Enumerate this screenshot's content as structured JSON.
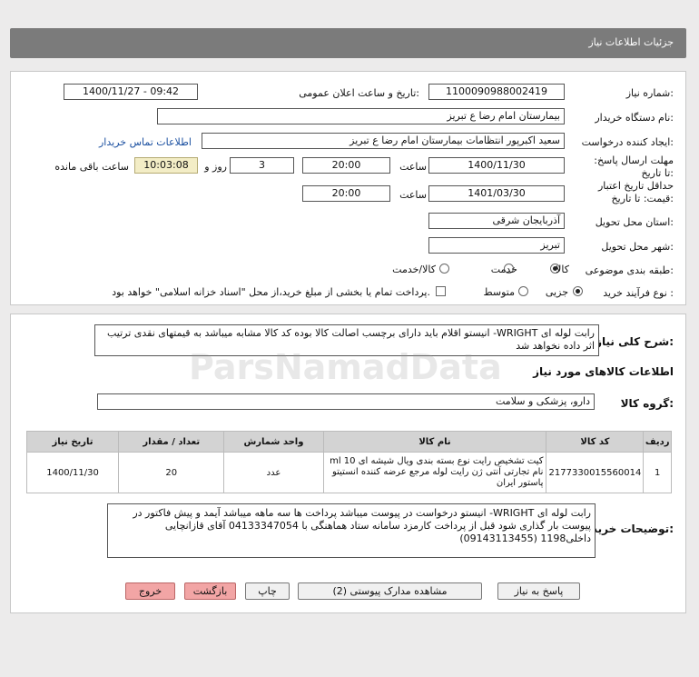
{
  "header": {
    "title": "جزئیات اطلاعات نیاز"
  },
  "form": {
    "need_number_label": "شماره نیاز:",
    "need_number": "1100090988002419",
    "announce_label": "تاریخ و ساعت اعلان عمومی:",
    "announce_value": "1400/11/27 - 09:42",
    "buyer_label": "نام دستگاه خریدار:",
    "buyer_value": "بیمارستان امام رضا  ع  تبریز",
    "creator_label": "ایجاد کننده درخواست:",
    "creator_value": "سعید اکبرپور انتظامات بیمارستان امام رضا  ع  تبریز",
    "contact_link": "اطلاعات تماس خریدار",
    "deadline_label": "مهلت ارسال پاسخ: تا تاریخ:",
    "deadline_date": "1400/11/30",
    "time_label": "ساعت",
    "deadline_time": "20:00",
    "days_value": "3",
    "days_label": "روز و",
    "remain_value": "10:03:08",
    "remain_label": "ساعت باقی مانده",
    "validity_label": "حداقل تاریخ اعتبار قیمت: تا تاریخ:",
    "validity_date": "1401/03/30",
    "validity_time": "20:00",
    "province_label": "استان محل تحویل:",
    "province_value": "آذربایجان شرقی",
    "city_label": "شهر محل تحویل:",
    "city_value": "تبریز",
    "category_label": "طبقه بندی موضوعی:",
    "category_options": [
      "کالا",
      "خدمت",
      "کالا/خدمت"
    ],
    "purchase_label": "نوع فرآیند خرید :",
    "purchase_options": [
      "جزیی",
      "متوسط"
    ],
    "payment_note": "پرداخت تمام یا بخشی از مبلغ خرید،از محل \"اسناد خزانه اسلامی\" خواهد بود."
  },
  "summary": {
    "label": "شرح کلی نیاز:",
    "text": "رابت لوله ای WRIGHT- انیستو اقلام باید دارای برچسب اصالت کالا بوده کد کالا مشابه میباشد به قیمتهای نقدی ترتیب اثر داده نخواهد شد",
    "goods_header": "اطلاعات کالاهای مورد نیاز",
    "group_label": "گروه کالا:",
    "group_value": "دارو، پزشکی و سلامت"
  },
  "table": {
    "headers": [
      "ردیف",
      "کد کالا",
      "نام کالا",
      "واحد شمارش",
      "تعداد / مقدار",
      "تاریخ نیاز"
    ],
    "rows": [
      [
        "1",
        "2177330015560014",
        "کیت تشخیص رایت نوع بسته بندی ویال شیشه ای 10 ml نام تجارتی آنتی ژن رایت لوله مرجع عرضه کننده انستیتو پاستور ایران",
        "عدد",
        "20",
        "1400/11/30"
      ]
    ]
  },
  "buyer_notes": {
    "label": "توضیحات خریدار:",
    "text": "رابت لوله ای WRIGHT- انیستو درخواست در پیوست میباشد پرداخت ها سه ماهه میباشد آیمد و پیش فاکتور در پیوست بار گذاری شود قبل از پرداخت کارمزد سامانه ستاد هماهنگی با 04133347054  آقای قازانچایی داخلی1198 (09143113455)"
  },
  "buttons": {
    "reply": "پاسخ به نیاز",
    "attachments": "مشاهده مدارک پیوستی (2)",
    "print": "چاپ",
    "back": "بازگشت",
    "exit": "خروج"
  },
  "watermark": {
    "text": "ParsNamadData"
  }
}
